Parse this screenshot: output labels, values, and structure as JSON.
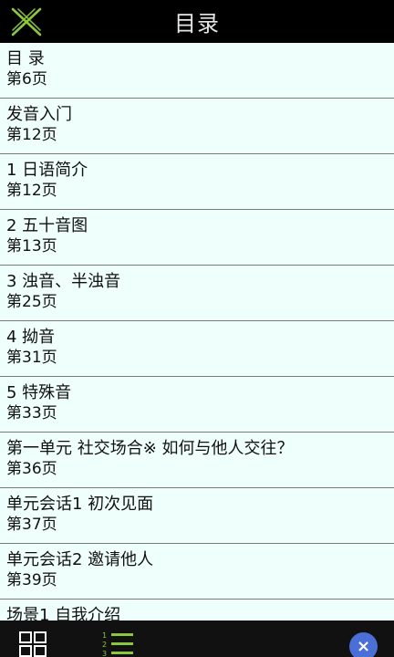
{
  "header": {
    "title": "目录",
    "close_icon": "close-x-icon",
    "accent_color": "#8cc63f"
  },
  "toc": {
    "items": [
      {
        "title": "目 录",
        "page": "第6页"
      },
      {
        "title": "发音入门",
        "page": "第12页"
      },
      {
        "title": "1 日语简介",
        "page": "第12页"
      },
      {
        "title": "2 五十音图",
        "page": "第13页"
      },
      {
        "title": "3 浊音、半浊音",
        "page": "第25页"
      },
      {
        "title": "4 拗音",
        "page": "第31页"
      },
      {
        "title": "5 特殊音",
        "page": "第33页"
      },
      {
        "title": "第一单元 社交场合※ 如何与他人交往？",
        "page": "第36页"
      },
      {
        "title": "单元会话1  初次见面",
        "page": "第37页"
      },
      {
        "title": "单元会话2  邀请他人",
        "page": "第39页"
      },
      {
        "title": "场景1 自我介绍",
        "page": ""
      }
    ]
  },
  "bottom_bar": {
    "grid_icon": "grid-view-icon",
    "toc_icon": "numbered-list-icon",
    "toc_numbers": [
      "1",
      "2",
      "3"
    ],
    "close_icon": "close-circle-icon",
    "close_glyph": "×",
    "close_color": "#4a6fd6"
  }
}
